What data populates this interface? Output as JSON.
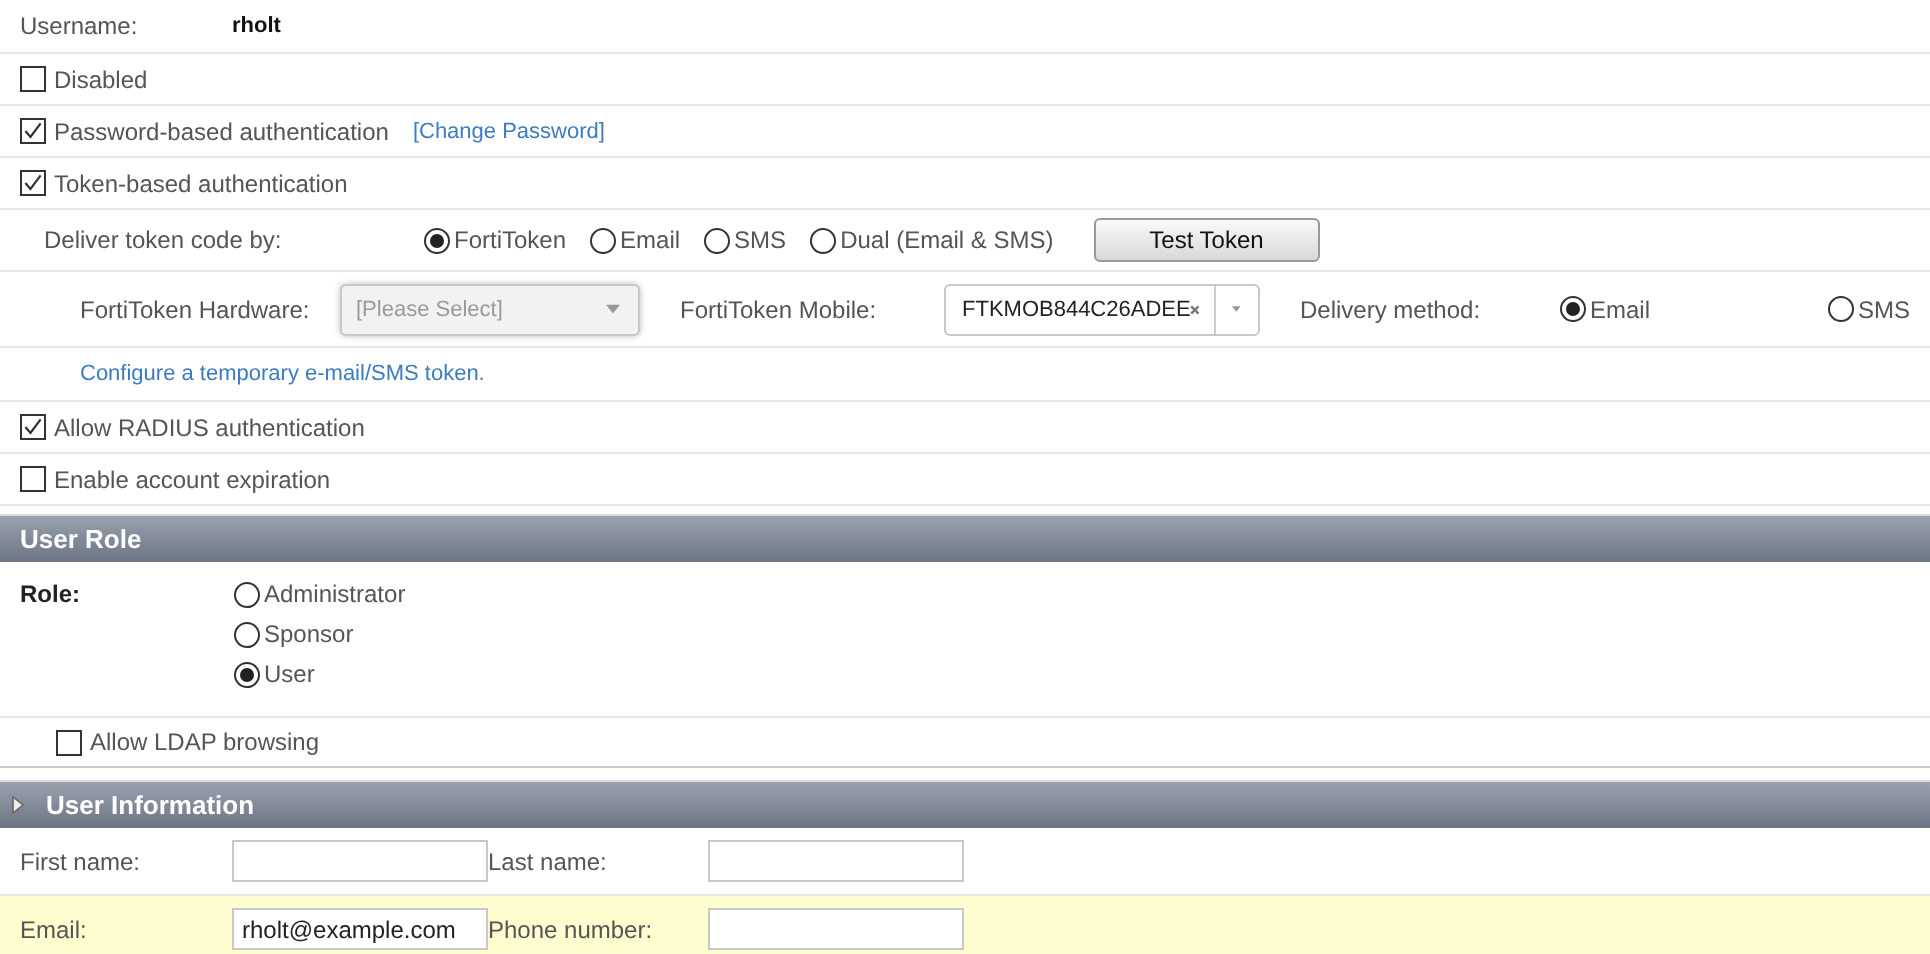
{
  "username": {
    "label": "Username:",
    "value": "rholt"
  },
  "auth_options": [
    {
      "label": "Disabled",
      "checked": false
    },
    {
      "label": "Password-based authentication",
      "checked": true,
      "link": "[Change Password]"
    },
    {
      "label": "Token-based authentication",
      "checked": true
    }
  ],
  "token": {
    "deliver_label": "Deliver token code by:",
    "methods": [
      {
        "label": "FortiToken",
        "selected": true
      },
      {
        "label": "Email",
        "selected": false
      },
      {
        "label": "SMS",
        "selected": false
      },
      {
        "label": "Dual (Email & SMS)",
        "selected": false
      }
    ],
    "test_button": "Test Token",
    "hardware_label": "FortiToken Hardware:",
    "hardware_placeholder": "[Please Select]",
    "mobile_label": "FortiToken Mobile:",
    "mobile_value": "FTKMOB844C26ADEE",
    "delivery_label": "Delivery method:",
    "delivery_methods": [
      {
        "label": "Email",
        "selected": true
      },
      {
        "label": "SMS",
        "selected": false
      }
    ],
    "configure_link": "Configure a temporary e-mail/SMS token."
  },
  "more_options": [
    {
      "label": "Allow RADIUS authentication",
      "checked": true
    },
    {
      "label": "Enable account expiration",
      "checked": false
    }
  ],
  "user_role": {
    "title": "User Role",
    "role_label": "Role:",
    "roles": [
      {
        "label": "Administrator",
        "selected": false
      },
      {
        "label": "Sponsor",
        "selected": false
      },
      {
        "label": "User",
        "selected": true
      }
    ],
    "ldap": {
      "label": "Allow LDAP browsing",
      "checked": false
    }
  },
  "user_information": {
    "title": "User Information",
    "rows": [
      {
        "highlighted": false,
        "fields": [
          {
            "label": "First name:"
          },
          {
            "label": "Last name:"
          }
        ]
      },
      {
        "highlighted": true,
        "fields": [
          {
            "label": "Email:",
            "value": "rholt@example.com"
          },
          {
            "label": "Phone number:"
          }
        ]
      }
    ]
  }
}
